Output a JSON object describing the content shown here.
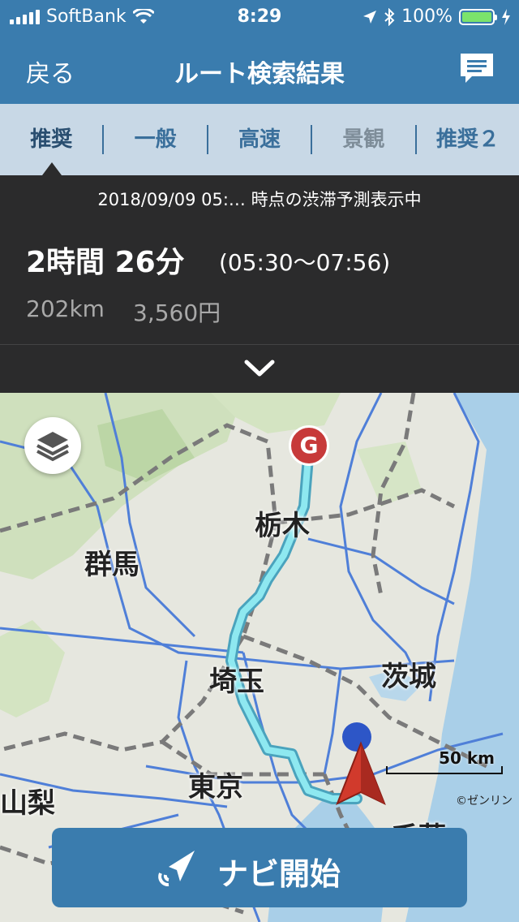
{
  "status": {
    "carrier": "SoftBank",
    "time": "8:29",
    "battery_percent": "100%",
    "battery_level": 1.0
  },
  "navbar": {
    "back_label": "戻る",
    "title": "ルート検索結果"
  },
  "tabs": [
    {
      "label": "推奨",
      "selected": true
    },
    {
      "label": "一般"
    },
    {
      "label": "高速"
    },
    {
      "label": "景観",
      "disabled": true
    },
    {
      "label": "推奨２"
    }
  ],
  "summary": {
    "notice": "2018/09/09 05:… 時点の渋滞予測表示中",
    "duration": "2時間 26分",
    "time_range": "(05:30〜07:56)",
    "distance": "202km",
    "cost": "3,560円"
  },
  "map": {
    "labels": {
      "tochigi": "栃木",
      "gunma": "群馬",
      "saitama": "埼玉",
      "ibaraki": "茨城",
      "tokyo": "東京",
      "yamanashi": "山梨",
      "chiba": "千葉"
    },
    "goal_marker": "G",
    "scale_text": "50 km",
    "copyright": "©ゼンリン"
  },
  "action": {
    "navi_start_label": "ナビ開始"
  },
  "colors": {
    "brand": "#3a7cae",
    "route": "#8ee8f0",
    "goal": "#c73a3a",
    "location": "#d13a2c"
  }
}
